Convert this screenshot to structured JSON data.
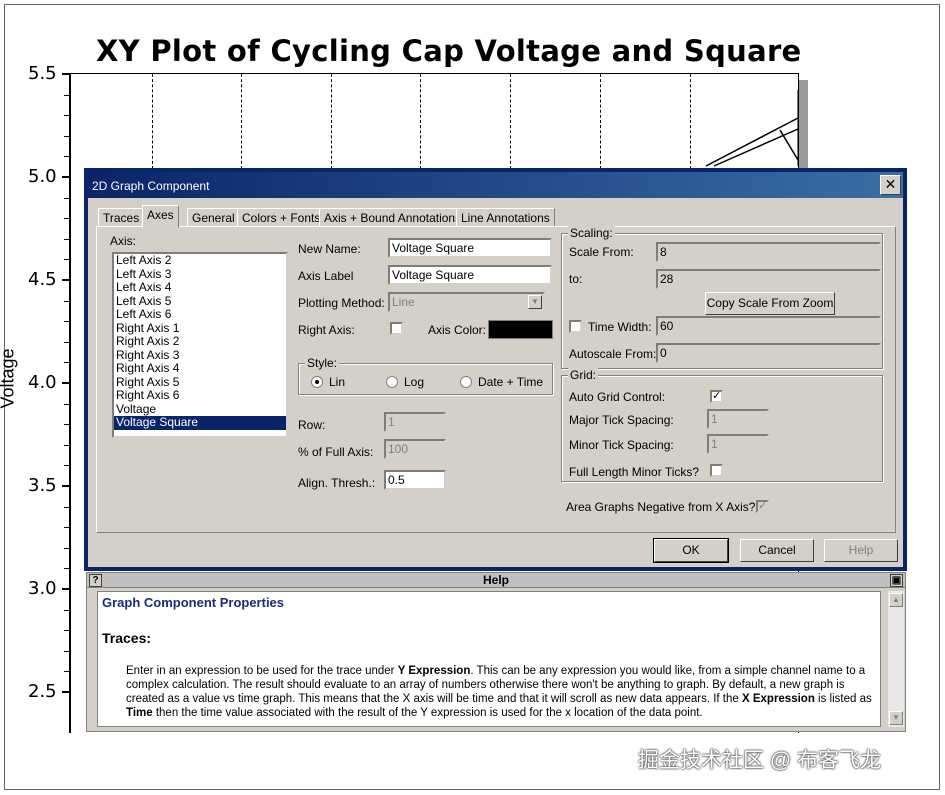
{
  "chart": {
    "title": "XY Plot of Cycling Cap Voltage and Square",
    "ylabel": "Voltage",
    "yticks": [
      "5.5",
      "5.0",
      "4.5",
      "4.0",
      "3.5",
      "3.0",
      "2.5"
    ]
  },
  "chart_data": {
    "type": "line",
    "title": "XY Plot of Cycling Cap Voltage and Square",
    "ylabel": "Voltage",
    "ylim": [
      2.5,
      5.5
    ],
    "yticks": [
      5.5,
      5.0,
      4.5,
      4.0,
      3.5,
      3.0,
      2.5
    ],
    "grid": true
  },
  "dialog": {
    "title": "2D Graph Component",
    "close_symbol": "✕",
    "tabs": [
      "Traces",
      "Axes",
      "General",
      "Colors + Fonts",
      "Axis + Bound Annotations",
      "Line Annotations"
    ],
    "active_tab": "Axes",
    "axis_list_label": "Axis:",
    "axis_list": [
      "Left Axis 2",
      "Left Axis 3",
      "Left Axis 4",
      "Left Axis 5",
      "Left Axis 6",
      "Right Axis 1",
      "Right Axis 2",
      "Right Axis 3",
      "Right Axis 4",
      "Right Axis 5",
      "Right Axis 6",
      "Voltage",
      "Voltage Square"
    ],
    "selected_axis": "Voltage Square",
    "new_name": {
      "label": "New Name:",
      "value": "Voltage Square"
    },
    "axis_label": {
      "label": "Axis Label",
      "value": "Voltage Square"
    },
    "plotting_method": {
      "label": "Plotting Method:",
      "value": "Line"
    },
    "right_axis": {
      "label": "Right Axis:",
      "checked": false
    },
    "axis_color": {
      "label": "Axis Color:",
      "value": "#000000"
    },
    "style": {
      "title": "Style:",
      "options": [
        "Lin",
        "Log",
        "Date + Time"
      ],
      "selected": "Lin"
    },
    "row": {
      "label": "Row:",
      "value": "1"
    },
    "pct_full_axis": {
      "label": "% of Full Axis:",
      "value": "100"
    },
    "align_thresh": {
      "label": "Align. Thresh.:",
      "value": "0.5"
    },
    "scaling": {
      "title": "Scaling:",
      "scale_from": {
        "label": "Scale From:",
        "value": "8"
      },
      "to": {
        "label": "to:",
        "value": "28"
      },
      "copy_button": "Copy Scale From Zoom",
      "time_width": {
        "label": "Time Width:",
        "value": "60",
        "checked": false
      },
      "autoscale_from": {
        "label": "Autoscale From:",
        "value": "0"
      }
    },
    "grid": {
      "title": "Grid:",
      "auto_grid": {
        "label": "Auto Grid Control:",
        "checked": true
      },
      "major_tick": {
        "label": "Major Tick Spacing:",
        "value": "1"
      },
      "minor_tick": {
        "label": "Minor Tick Spacing:",
        "value": "1"
      },
      "full_length": {
        "label": "Full Length Minor Ticks?",
        "checked": false
      }
    },
    "area_graphs": {
      "label": "Area Graphs Negative from X Axis?",
      "checked": true
    },
    "buttons": {
      "ok": "OK",
      "cancel": "Cancel",
      "help": "Help"
    }
  },
  "help": {
    "bar_title": "Help",
    "question_icon": "?",
    "heading": "Graph Component Properties",
    "section": "Traces:",
    "para": [
      {
        "t": "Enter in an expression to be used for the trace under ",
        "b": false
      },
      {
        "t": "Y Expression",
        "b": true
      },
      {
        "t": ".  This can be any expression you would like, from a simple channel name to a complex calculation.  The result should evaluate to an array of numbers otherwise there won't be anything to graph.  By default, a new graph is created as a value vs time graph.  This means that the X axis will be time and that it will scroll as new data appears.  If the ",
        "b": false
      },
      {
        "t": "X Expression",
        "b": true
      },
      {
        "t": " is listed as ",
        "b": false
      },
      {
        "t": "Time",
        "b": true
      },
      {
        "t": " then the time value associated with the result of the Y expression is used for the x location of the data point.",
        "b": false
      }
    ]
  },
  "watermark": "掘金技术社区 @ 布客飞龙"
}
